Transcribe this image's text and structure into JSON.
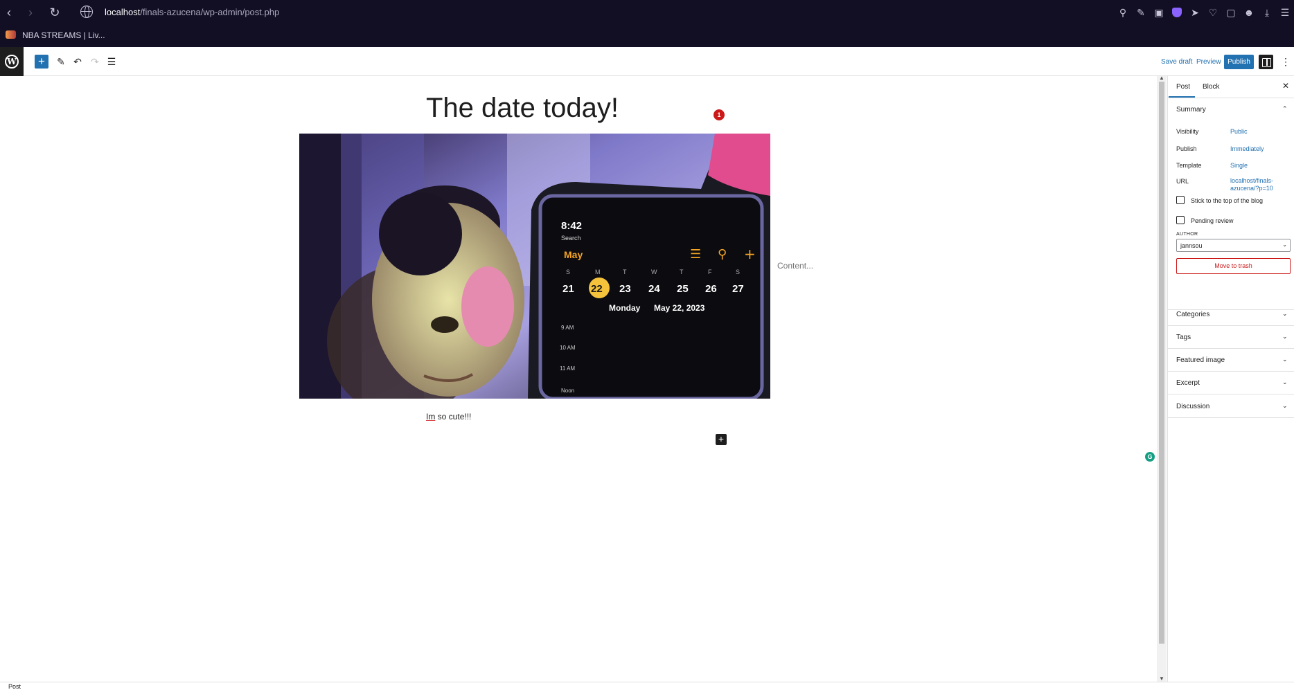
{
  "browser": {
    "url_host": "localhost",
    "url_path": "/finals-azucena/wp-admin/post.php",
    "bookmark": "NBA STREAMS | Liv...",
    "ext_icons": [
      "search-icon",
      "edit-icon",
      "camera-icon",
      "shield-icon",
      "send-icon",
      "heart-icon",
      "box-icon",
      "profile-icon",
      "download-icon",
      "menu-icon"
    ]
  },
  "toolbar": {
    "save_draft": "Save draft",
    "preview": "Preview",
    "publish": "Publish",
    "inserter": "+"
  },
  "editor": {
    "title": "The date today!",
    "notification_count": "1",
    "content_placeholder": "Content...",
    "paragraph_first": "Im",
    "paragraph_rest": " so cute!!!",
    "add_block": "+",
    "grammarly": "G",
    "photo": {
      "phone_time": "8:42",
      "phone_back": "Search",
      "phone_month": "May",
      "weekdays": [
        "S",
        "M",
        "T",
        "W",
        "T",
        "F",
        "S"
      ],
      "dates": [
        "21",
        "22",
        "23",
        "24",
        "25",
        "26",
        "27"
      ],
      "phone_date_day": "Monday",
      "phone_date_full": "May 22, 2023",
      "hours": [
        "9 AM",
        "10 AM",
        "11 AM",
        "Noon"
      ]
    }
  },
  "sidebar": {
    "tabs": [
      "Post",
      "Block"
    ],
    "summary_title": "Summary",
    "visibility_label": "Visibility",
    "visibility_value": "Public",
    "publish_label": "Publish",
    "publish_value": "Immediately",
    "template_label": "Template",
    "template_value": "Single",
    "url_label": "URL",
    "url_value": "localhost/finals-azucena/?p=10",
    "stick_label": "Stick to the top of the blog",
    "pending_label": "Pending review",
    "author_label": "AUTHOR",
    "author_value": "jannsou",
    "trash_label": "Move to trash",
    "panels": [
      "Categories",
      "Tags",
      "Featured image",
      "Excerpt",
      "Discussion"
    ]
  },
  "footer": {
    "breadcrumb": "Post"
  },
  "colors": {
    "browser_bg": "#120f24",
    "wp_accent": "#2271b1",
    "danger": "#cc1818"
  }
}
